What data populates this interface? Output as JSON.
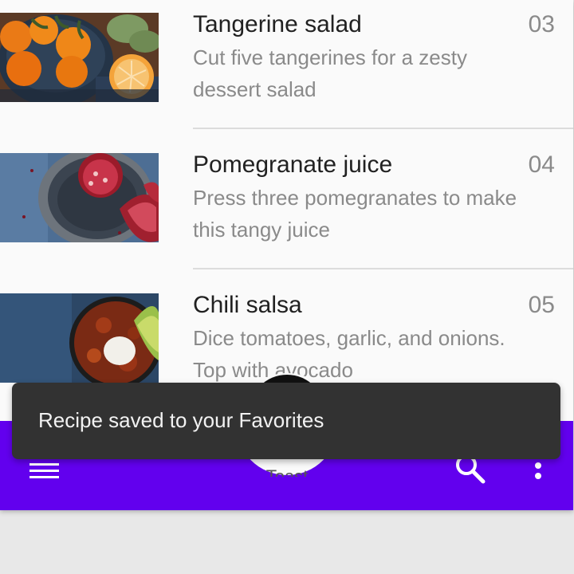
{
  "recipes": [
    {
      "title": "Tangerine salad",
      "number": "03",
      "description": "Cut five tangerines for a zesty dessert salad",
      "image": "tangerines-photo"
    },
    {
      "title": "Pomegranate juice",
      "number": "04",
      "description": "Press three pomegranates to make this tangy juice",
      "image": "pomegranates-photo"
    },
    {
      "title": "Chili salsa",
      "number": "05",
      "description": "Dice tomatoes, garlic, and onions. Top with avocado",
      "image": "chili-salsa-photo"
    }
  ],
  "bottom_app_bar": {
    "color": "#6200ee",
    "icons": [
      "menu-icon",
      "search-icon",
      "more-vert-icon"
    ],
    "fab_label": "Toast"
  },
  "snackbar": {
    "message": "Recipe saved to your Favorites"
  }
}
